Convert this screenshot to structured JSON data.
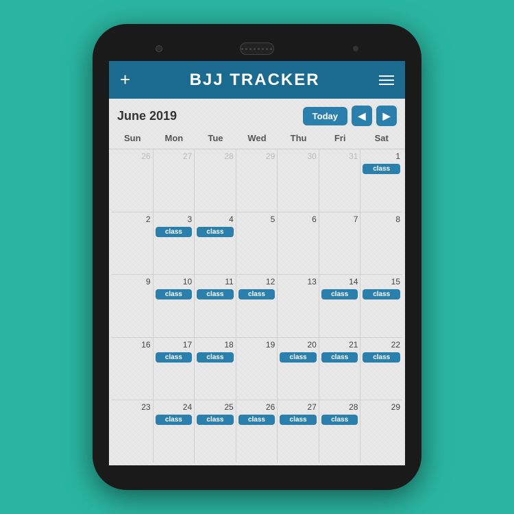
{
  "app": {
    "title": "BJJ TRACKER",
    "plus_label": "+",
    "header_menu_aria": "menu"
  },
  "calendar": {
    "month_label": "June 2019",
    "today_btn": "Today",
    "nav_prev": "◀",
    "nav_next": "▶",
    "day_headers": [
      "Sun",
      "Mon",
      "Tue",
      "Wed",
      "Thu",
      "Fri",
      "Sat"
    ],
    "weeks": [
      [
        {
          "num": "26",
          "dim": true,
          "class": false
        },
        {
          "num": "27",
          "dim": true,
          "class": false
        },
        {
          "num": "28",
          "dim": true,
          "class": false
        },
        {
          "num": "29",
          "dim": true,
          "class": false
        },
        {
          "num": "30",
          "dim": true,
          "class": false
        },
        {
          "num": "31",
          "dim": true,
          "class": false
        },
        {
          "num": "1",
          "dim": false,
          "class": true
        }
      ],
      [
        {
          "num": "2",
          "dim": false,
          "class": false
        },
        {
          "num": "3",
          "dim": false,
          "class": true
        },
        {
          "num": "4",
          "dim": false,
          "class": true
        },
        {
          "num": "5",
          "dim": false,
          "class": false
        },
        {
          "num": "6",
          "dim": false,
          "class": false
        },
        {
          "num": "7",
          "dim": false,
          "class": false
        },
        {
          "num": "8",
          "dim": false,
          "class": false
        }
      ],
      [
        {
          "num": "9",
          "dim": false,
          "class": false
        },
        {
          "num": "10",
          "dim": false,
          "class": true
        },
        {
          "num": "11",
          "dim": false,
          "class": true
        },
        {
          "num": "12",
          "dim": false,
          "class": true
        },
        {
          "num": "13",
          "dim": false,
          "class": false
        },
        {
          "num": "14",
          "dim": false,
          "class": true
        },
        {
          "num": "15",
          "dim": false,
          "class": true
        }
      ],
      [
        {
          "num": "16",
          "dim": false,
          "class": false
        },
        {
          "num": "17",
          "dim": false,
          "class": true
        },
        {
          "num": "18",
          "dim": false,
          "class": true
        },
        {
          "num": "19",
          "dim": false,
          "class": false
        },
        {
          "num": "20",
          "dim": false,
          "class": true
        },
        {
          "num": "21",
          "dim": false,
          "class": true
        },
        {
          "num": "22",
          "dim": false,
          "class": true
        }
      ],
      [
        {
          "num": "23",
          "dim": false,
          "class": false
        },
        {
          "num": "24",
          "dim": false,
          "class": true
        },
        {
          "num": "25",
          "dim": false,
          "class": true
        },
        {
          "num": "26",
          "dim": false,
          "class": true
        },
        {
          "num": "27",
          "dim": false,
          "class": true
        },
        {
          "num": "28",
          "dim": false,
          "class": true
        },
        {
          "num": "29",
          "dim": false,
          "class": false
        }
      ]
    ],
    "class_label": "class"
  },
  "colors": {
    "teal_bg": "#2ab5a0",
    "header_blue": "#1b6a8f",
    "btn_blue": "#2b7fad"
  }
}
